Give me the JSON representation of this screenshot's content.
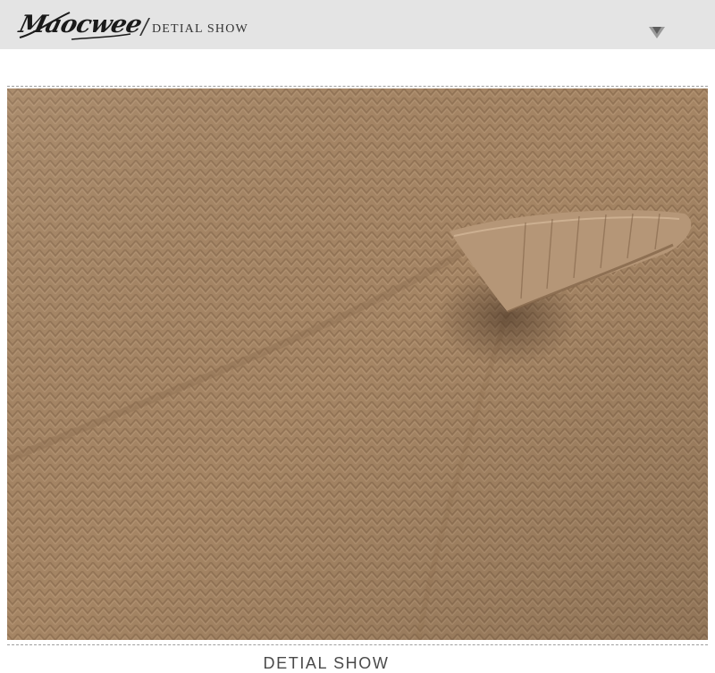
{
  "header": {
    "brand": "Maocwee",
    "divider": "/",
    "title": "DETIAL SHOW",
    "icons": {
      "dropdown": "chevron-down-icon"
    }
  },
  "main": {
    "photo": {
      "subject": "knit-fabric-detail",
      "colors": {
        "base": "#a58564",
        "light": "#b59677",
        "dark": "#7d5f44",
        "shadow": "#5e4532"
      }
    }
  },
  "footer": {
    "caption": "DETIAL SHOW"
  }
}
